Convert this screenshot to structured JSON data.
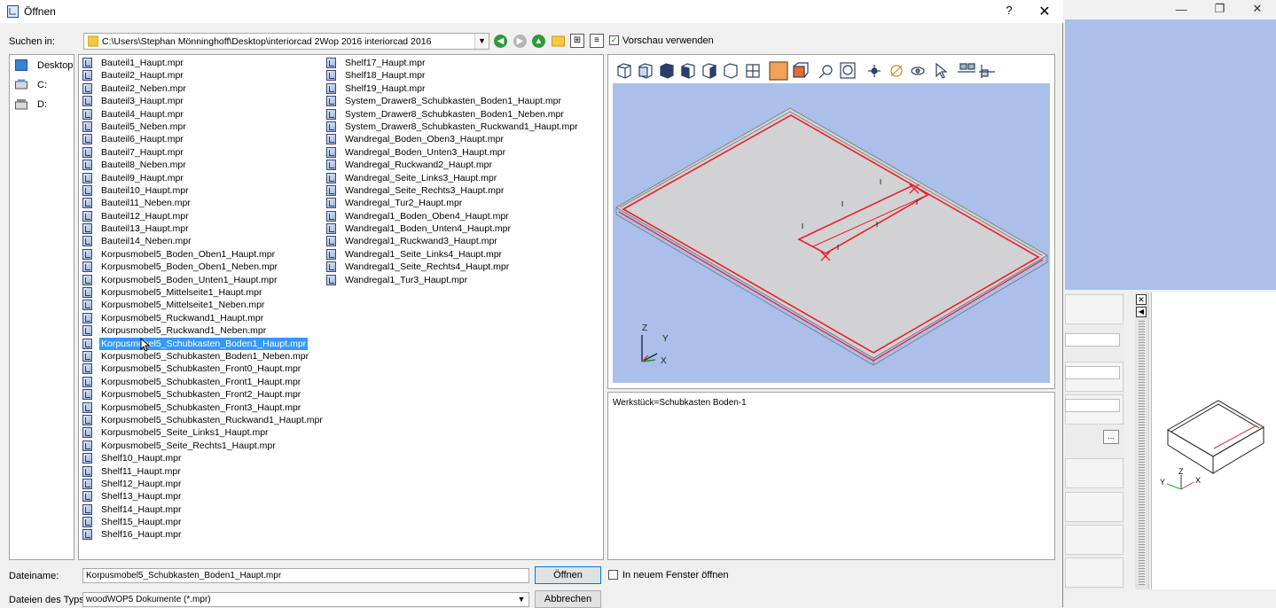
{
  "dialog": {
    "title": "Öffnen",
    "help_label": "?",
    "close_label": "✕"
  },
  "look_in": {
    "label": "Suchen in:",
    "path": "C:\\Users\\Stephan Mönninghoff\\Desktop\\interiorcad 2Wop 2016 interiorcad 2016"
  },
  "preview_checkbox": {
    "label": "Vorschau verwenden",
    "checked": true
  },
  "places": [
    "Desktop",
    "C:",
    "D:"
  ],
  "files_column_1": [
    "Bauteil1_Haupt.mpr",
    "Bauteil2_Haupt.mpr",
    "Bauteil2_Neben.mpr",
    "Bauteil3_Haupt.mpr",
    "Bauteil4_Haupt.mpr",
    "Bauteil5_Neben.mpr",
    "Bauteil6_Haupt.mpr",
    "Bauteil7_Haupt.mpr",
    "Bauteil8_Neben.mpr",
    "Bauteil9_Haupt.mpr",
    "Bauteil10_Haupt.mpr",
    "Bauteil11_Neben.mpr",
    "Bauteil12_Haupt.mpr",
    "Bauteil13_Haupt.mpr",
    "Bauteil14_Neben.mpr",
    "Korpusmobel5_Boden_Oben1_Haupt.mpr",
    "Korpusmobel5_Boden_Oben1_Neben.mpr",
    "Korpusmobel5_Boden_Unten1_Haupt.mpr",
    "Korpusmobel5_Mittelseite1_Haupt.mpr",
    "Korpusmobel5_Mittelseite1_Neben.mpr",
    "Korpusmobel5_Ruckwand1_Haupt.mpr",
    "Korpusmobel5_Ruckwand1_Neben.mpr",
    "Korpusmobel5_Schubkasten_Boden1_Haupt.mpr",
    "Korpusmobel5_Schubkasten_Boden1_Neben.mpr",
    "Korpusmobel5_Schubkasten_Front0_Haupt.mpr",
    "Korpusmobel5_Schubkasten_Front1_Haupt.mpr",
    "Korpusmobel5_Schubkasten_Front2_Haupt.mpr",
    "Korpusmobel5_Schubkasten_Front3_Haupt.mpr",
    "Korpusmobel5_Schubkasten_Ruckwand1_Haupt.mpr",
    "Korpusmobel5_Seite_Links1_Haupt.mpr",
    "Korpusmobel5_Seite_Rechts1_Haupt.mpr",
    "Shelf10_Haupt.mpr",
    "Shelf11_Haupt.mpr",
    "Shelf12_Haupt.mpr",
    "Shelf13_Haupt.mpr",
    "Shelf14_Haupt.mpr",
    "Shelf15_Haupt.mpr",
    "Shelf16_Haupt.mpr"
  ],
  "files_column_2": [
    "Shelf17_Haupt.mpr",
    "Shelf18_Haupt.mpr",
    "Shelf19_Haupt.mpr",
    "System_Drawer8_Schubkasten_Boden1_Haupt.mpr",
    "System_Drawer8_Schubkasten_Boden1_Neben.mpr",
    "System_Drawer8_Schubkasten_Ruckwand1_Haupt.mpr",
    "Wandregal_Boden_Oben3_Haupt.mpr",
    "Wandregal_Boden_Unten3_Haupt.mpr",
    "Wandregal_Ruckwand2_Haupt.mpr",
    "Wandregal_Seite_Links3_Haupt.mpr",
    "Wandregal_Seite_Rechts3_Haupt.mpr",
    "Wandregal_Tur2_Haupt.mpr",
    "Wandregal1_Boden_Oben4_Haupt.mpr",
    "Wandregal1_Boden_Unten4_Haupt.mpr",
    "Wandregal1_Ruckwand3_Haupt.mpr",
    "Wandregal1_Seite_Links4_Haupt.mpr",
    "Wandregal1_Seite_Rechts4_Haupt.mpr",
    "Wandregal1_Tur3_Haupt.mpr"
  ],
  "selected_file": "Korpusmobel5_Schubkasten_Boden1_Haupt.mpr",
  "preview": {
    "axis_labels": {
      "z": "Z",
      "y": "Y",
      "x": "X"
    },
    "info": "Werkstück=Schubkasten Boden-1"
  },
  "filename": {
    "label": "Dateiname:",
    "value": "Korpusmobel5_Schubkasten_Boden1_Haupt.mpr"
  },
  "filetype": {
    "label": "Dateien des Typs:",
    "value": "woodWOP5 Dokumente (*.mpr)"
  },
  "buttons": {
    "open": "Öffnen",
    "cancel": "Abbrechen"
  },
  "new_window_checkbox": {
    "label": "In neuem Fenster öffnen",
    "checked": false
  },
  "background_window": {
    "controls": [
      "—",
      "❐",
      "✕"
    ],
    "dots_label": "...",
    "axis_labels": {
      "z": "Z",
      "y": "Y",
      "x": "X"
    }
  },
  "colors": {
    "viewport": "#aabfea",
    "selection": "#3399ff",
    "model_edge": "#e8202a"
  }
}
